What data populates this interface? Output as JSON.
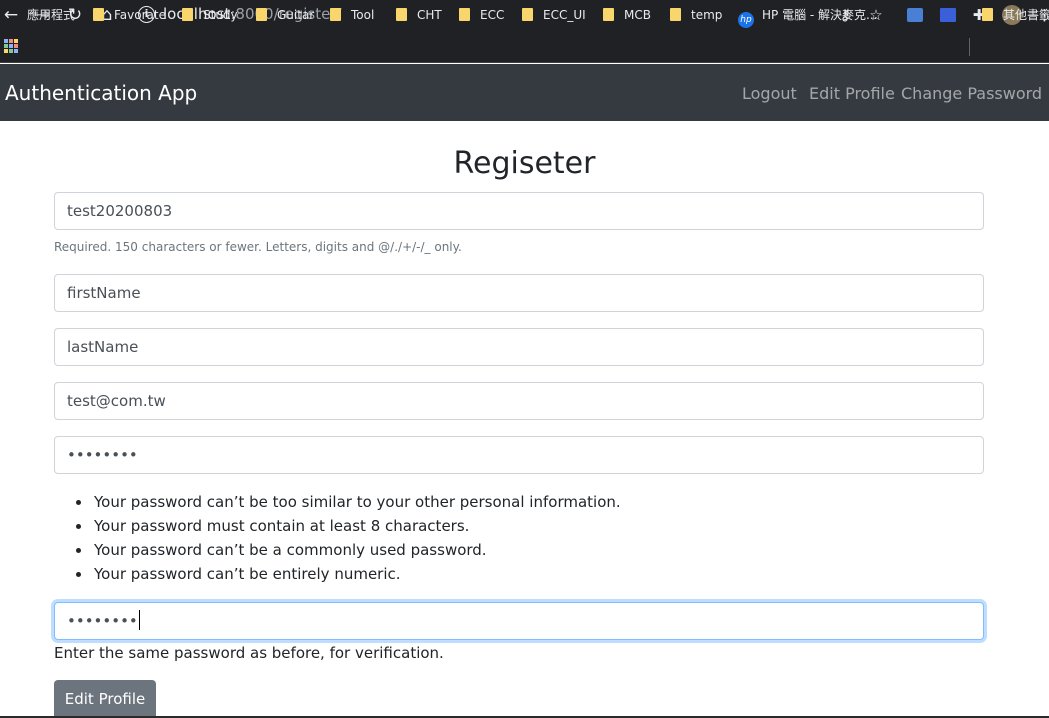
{
  "browser": {
    "url_host": "localhost",
    "url_rest": ":8000/register/",
    "bookmarks": [
      {
        "label": "應用程式",
        "icon": "apps-grid-icon"
      },
      {
        "label": "Favorate",
        "icon": "folder-icon"
      },
      {
        "label": "Study",
        "icon": "folder-icon"
      },
      {
        "label": "Guitar",
        "icon": "folder-icon"
      },
      {
        "label": "Tool",
        "icon": "folder-icon"
      },
      {
        "label": "CHT",
        "icon": "folder-icon"
      },
      {
        "label": "ECC",
        "icon": "folder-icon"
      },
      {
        "label": "ECC_UI",
        "icon": "folder-icon"
      },
      {
        "label": "MCB",
        "icon": "folder-icon"
      },
      {
        "label": "temp",
        "icon": "folder-icon"
      },
      {
        "label": "HP 電腦 - 解決麥克...",
        "icon": "hp-icon"
      },
      {
        "label": "其他書籤",
        "icon": "folder-icon"
      }
    ]
  },
  "navbar": {
    "brand": "Authentication App",
    "links": [
      "Logout",
      "Edit Profile",
      "Change Password"
    ]
  },
  "form": {
    "title": "Regiseter",
    "username": "test20200803",
    "username_help": "Required. 150 characters or fewer. Letters, digits and @/./+/-/_ only.",
    "first_name": "firstName",
    "last_name": "lastName",
    "email": "test@com.tw",
    "password1": "••••••••",
    "password_rules": [
      "Your password can’t be too similar to your other personal information.",
      "Your password must contain at least 8 characters.",
      "Your password can’t be a commonly used password.",
      "Your password can’t be entirely numeric."
    ],
    "password2": "••••••••",
    "password2_help": "Enter the same password as before, for verification.",
    "submit_label": "Edit Profile"
  },
  "colors": {
    "navbar_bg": "#343a40",
    "button_bg": "#6c757d",
    "focus_border": "#80bdff"
  }
}
